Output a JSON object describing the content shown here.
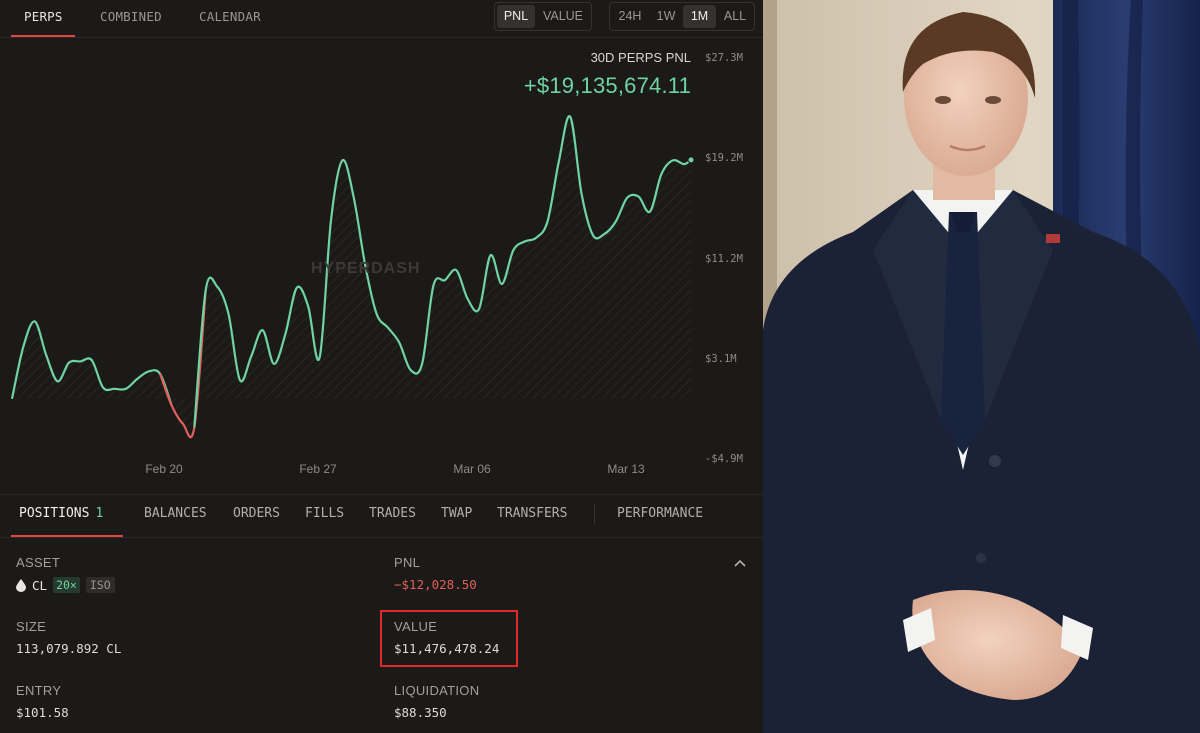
{
  "top_tabs": [
    "PERPS",
    "COMBINED",
    "CALENDAR"
  ],
  "mode_toggle": [
    "PNL",
    "VALUE"
  ],
  "range_toggle": [
    "24H",
    "1W",
    "1M",
    "ALL"
  ],
  "chart_title": "30D PERPS PNL",
  "chart_value": "+$19,135,674.11",
  "watermark": "HYPERDASH",
  "colors": {
    "positive": "#6fd4a2",
    "negative": "#e0605a",
    "accent": "#e0483f",
    "highlight": "#e02a28"
  },
  "chart_data": {
    "type": "line",
    "title": "30D PERPS PNL",
    "x_tick_labels": [
      "Feb 20",
      "Feb 27",
      "Mar 06",
      "Mar 13"
    ],
    "y_tick_labels": [
      "$27.3M",
      "$19.2M",
      "$11.2M",
      "$3.1M",
      "-$4.9M"
    ],
    "ylim": [
      -4.9,
      27.3
    ],
    "y_unit": "$M",
    "x": [
      15.0,
      15.5,
      16.0,
      16.5,
      17.0,
      17.5,
      18.0,
      18.5,
      19.0,
      19.5,
      20.0,
      20.5,
      21.0,
      21.5,
      22.0,
      22.5,
      23.0,
      23.5,
      24.0,
      24.5,
      25.0,
      25.5,
      26.0,
      26.5,
      27.0,
      27.5,
      28.0,
      28.5,
      29.0,
      29.5,
      30.0,
      30.5,
      31.0,
      31.5,
      32.0,
      32.5,
      33.0,
      33.5,
      34.0,
      34.5,
      35.0,
      35.5,
      36.0,
      36.5,
      37.0,
      37.5,
      38.0,
      38.5,
      39.0,
      39.5,
      40.0,
      40.5,
      41.0,
      41.5,
      42.0,
      42.5,
      43.0,
      43.5,
      44.0,
      44.5,
      44.8
    ],
    "values": [
      0.0,
      4.2,
      6.2,
      3.5,
      1.4,
      2.9,
      3.0,
      3.1,
      0.9,
      0.8,
      0.8,
      1.6,
      2.2,
      2.0,
      -0.5,
      -2.0,
      -2.3,
      8.7,
      9.0,
      6.8,
      1.5,
      3.4,
      5.5,
      2.8,
      5.2,
      8.9,
      7.4,
      3.3,
      14.3,
      19.1,
      16.1,
      10.7,
      6.8,
      5.7,
      4.5,
      2.3,
      2.8,
      9.1,
      9.5,
      10.3,
      8.0,
      7.2,
      11.5,
      9.2,
      11.9,
      12.6,
      12.9,
      14.2,
      19.0,
      22.6,
      16.4,
      13.1,
      13.2,
      14.2,
      16.1,
      16.2,
      15.0,
      18.0,
      19.1,
      18.8,
      19.14
    ],
    "line_color_positive": "#6fd4a2",
    "line_color_negative": "#e0605a",
    "grid": false
  },
  "bottom_tabs": {
    "positions_label": "POSITIONS",
    "positions_count": "1",
    "others": [
      "BALANCES",
      "ORDERS",
      "FILLS",
      "TRADES",
      "TWAP",
      "TRANSFERS"
    ],
    "performance": "PERFORMANCE"
  },
  "position": {
    "asset_label": "ASSET",
    "asset_name": "CL",
    "leverage": "20×",
    "margin_mode": "ISO",
    "pnl_label": "PNL",
    "pnl_value": "−$12,028.50",
    "size_label": "SIZE",
    "size_value": "113,079.892 CL",
    "value_label": "VALUE",
    "value_value": "$11,476,478.24",
    "entry_label": "ENTRY",
    "entry_value": "$101.58",
    "liquidation_label": "LIQUIDATION",
    "liquidation_value": "$88.350"
  }
}
